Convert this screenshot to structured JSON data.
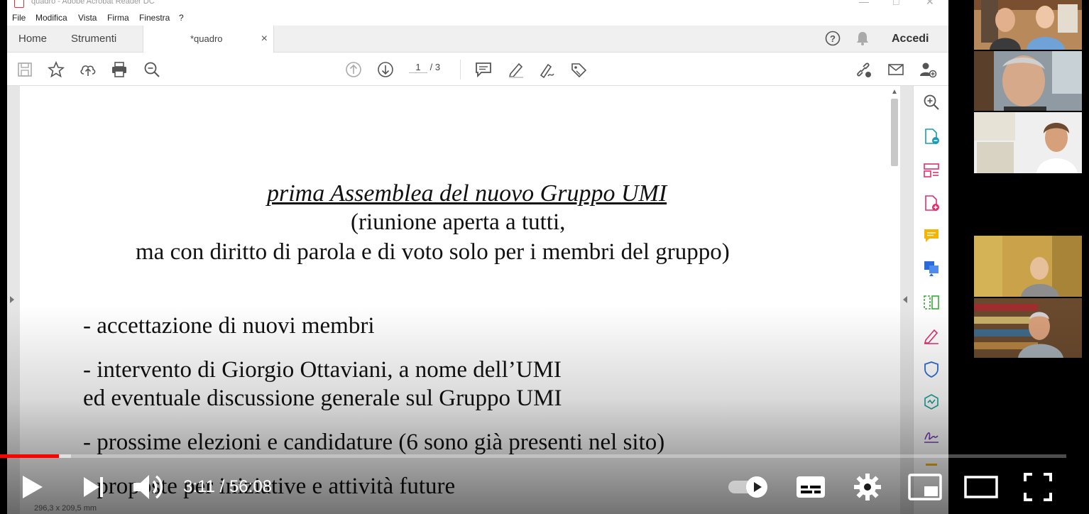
{
  "window": {
    "title": "quadro - Adobe Acrobat Reader DC",
    "menu": [
      "File",
      "Modifica",
      "Vista",
      "Firma",
      "Finestra",
      "?"
    ]
  },
  "tabs": {
    "home": "Home",
    "tools": "Strumenti",
    "document": "*quadro",
    "close": "×",
    "signin": "Accedi"
  },
  "toolbar": {
    "page_current": "1",
    "page_total": "/ 3"
  },
  "document": {
    "title": "prima Assemblea del nuovo Gruppo UMI",
    "subtitle_1": "(riunione aperta a tutti,",
    "subtitle_2": "ma con diritto di parola e di voto solo per i membri del gruppo)",
    "items": [
      "- accettazione di nuovi membri",
      "- intervento di Giorgio Ottaviani, a nome dell’UMI",
      "ed eventuale discussione generale sul Gruppo UMI",
      "- prossime elezioni e candidature (6 sono già presenti nel sito)",
      "- proposte per iniziative e attività future"
    ],
    "page_size": "296,3 x 209,5 mm"
  },
  "player": {
    "current_time": "3:11",
    "separator": " / ",
    "duration": "56:08",
    "progress_fraction": 0.055
  }
}
